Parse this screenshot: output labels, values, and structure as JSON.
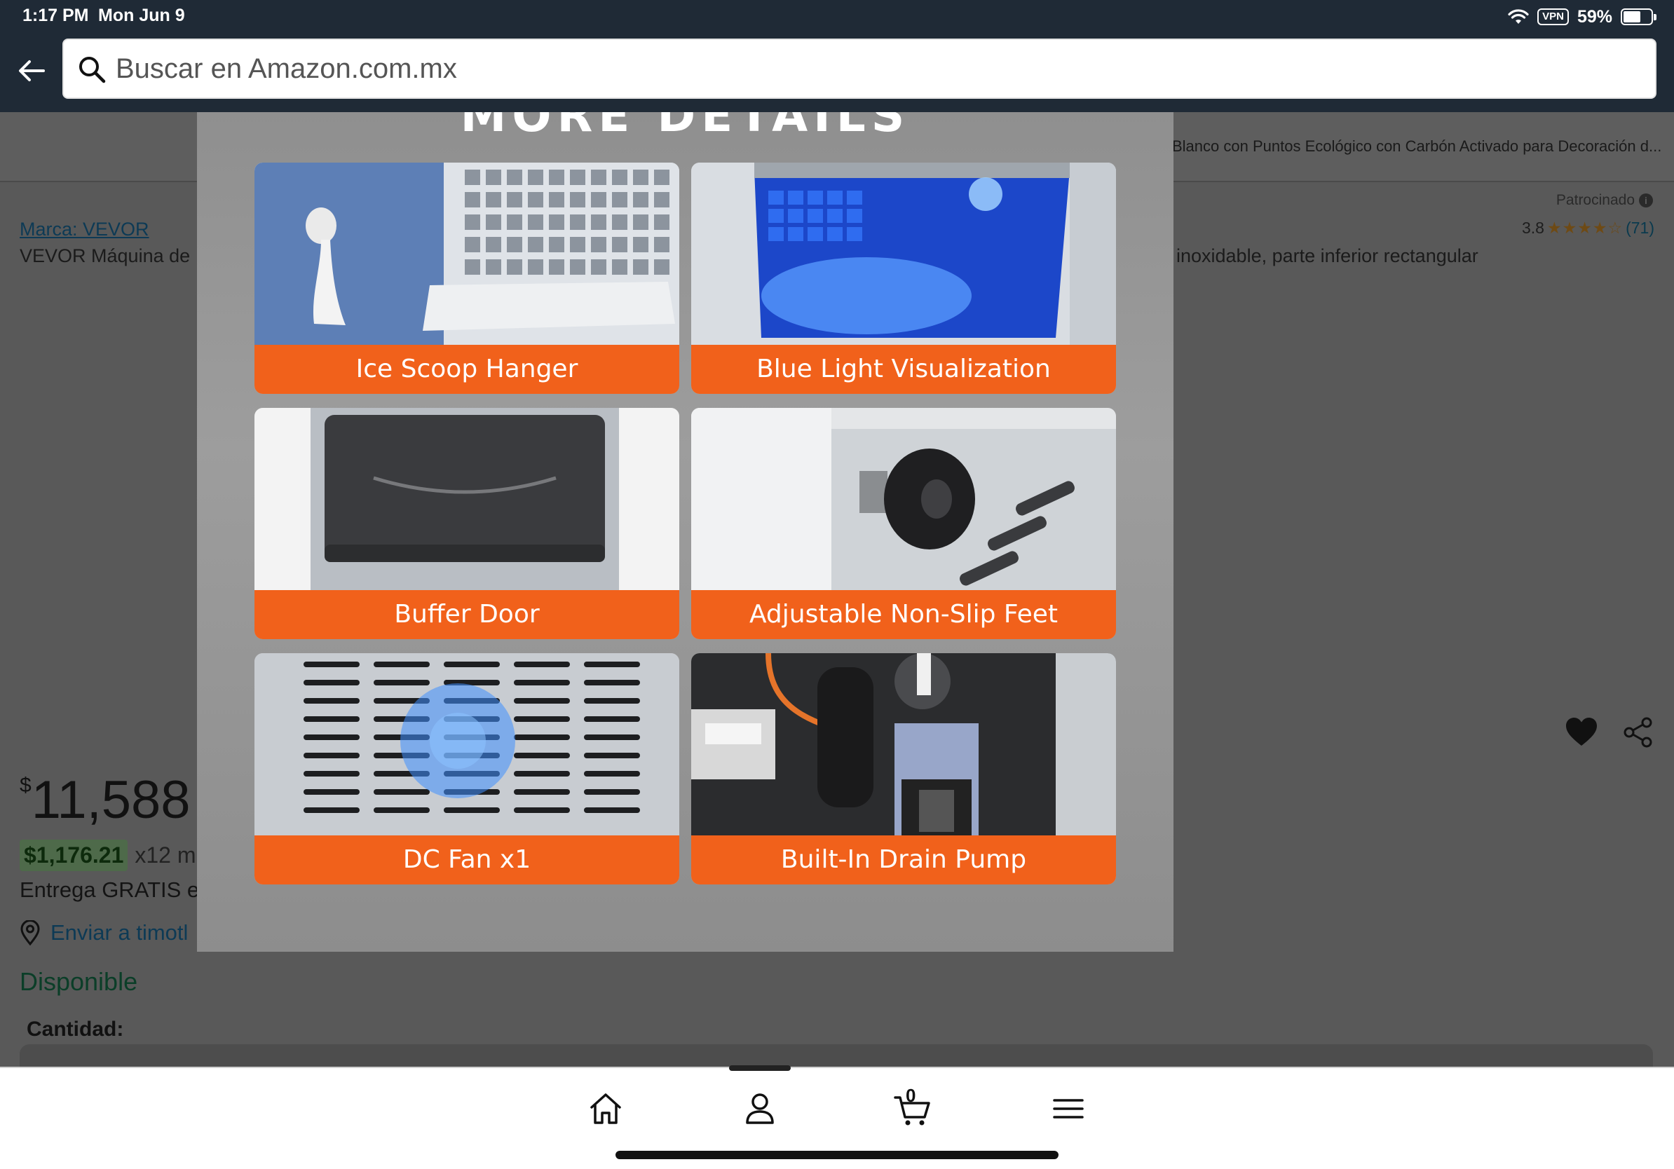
{
  "status_bar": {
    "time": "1:17 PM",
    "date": "Mon Jun 9",
    "vpn": "VPN",
    "battery": "59%"
  },
  "search": {
    "placeholder": "Buscar en Amazon.com.mx"
  },
  "page": {
    "banner_text": "Blanco con Puntos Ecológico con Carbón Activado para Decoración d...",
    "sponsored": "Patrocinado",
    "rating_value": "3.8",
    "rating_stars": "★★★★☆",
    "rating_count": "(71)",
    "brand_link": "Marca: VEVOR",
    "title_left": "VEVOR Máquina de",
    "title_right": "inoxidable, parte inferior rectangular",
    "price_currency": "$",
    "price_amount": "11,588",
    "installment_amount": "$1,176.21",
    "installment_suffix": "x12 m",
    "delivery": "Entrega GRATIS e",
    "ship_to": "Enviar a timotl",
    "availability": "Disponible",
    "quantity_label": "Cantidad:"
  },
  "modal": {
    "heading": "MORE DETAILS",
    "tiles": [
      {
        "label": "Ice Scoop Hanger"
      },
      {
        "label": "Blue Light Visualization"
      },
      {
        "label": "Buffer Door"
      },
      {
        "label": "Adjustable Non-Slip Feet"
      },
      {
        "label": "DC Fan x1"
      },
      {
        "label": "Built-In Drain Pump"
      }
    ]
  },
  "bottom_nav": {
    "cart_count": "0",
    "items": [
      "home-icon",
      "account-icon",
      "cart-icon",
      "menu-icon"
    ]
  },
  "colors": {
    "header": "#1f2a36",
    "label_orange": "#f1611b"
  }
}
